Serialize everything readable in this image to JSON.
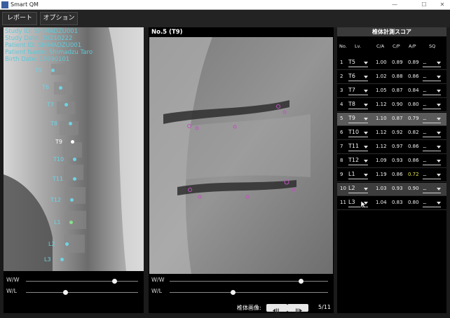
{
  "window": {
    "title": "Smart QM"
  },
  "toolbar": {
    "report_label": "レポート",
    "options_label": "オプション"
  },
  "left_pane": {
    "info": {
      "study_id": "Study ID: SHIMADZU001",
      "study_date": "Study Date: 20210222",
      "patient_id": "Patient ID: SHIMADZU001",
      "patient_name": "Patient Name: Shimadzu Taro",
      "birth_date": "Birth Date: 19990101"
    },
    "vertebrae": [
      "T5",
      "T6",
      "T7",
      "T8",
      "T9",
      "T10",
      "T11",
      "T12",
      "L1",
      "L2",
      "L3"
    ],
    "ww_label": "W/W",
    "wl_label": "W/L",
    "ww_value": 0.79,
    "wl_value": 0.35
  },
  "center_pane": {
    "title": "No.5 (T9)",
    "ww_label": "W/W",
    "wl_label": "W/L",
    "ww_value": 0.83,
    "wl_value": 0.4,
    "nav_label": "椎体画像:",
    "page_counter": "5/11"
  },
  "score_panel": {
    "title": "椎体計測スコア",
    "columns": [
      "No.",
      "Lv.",
      "C/A",
      "C/P",
      "A/P",
      "SQ"
    ],
    "rows": [
      {
        "no": "1",
        "lv": "T5",
        "ca": "1.00",
        "cp": "0.89",
        "ap": "0.89",
        "sq": "..."
      },
      {
        "no": "2",
        "lv": "T6",
        "ca": "1.02",
        "cp": "0.88",
        "ap": "0.86",
        "sq": "..."
      },
      {
        "no": "3",
        "lv": "T7",
        "ca": "1.05",
        "cp": "0.87",
        "ap": "0.84",
        "sq": "..."
      },
      {
        "no": "4",
        "lv": "T8",
        "ca": "1.12",
        "cp": "0.90",
        "ap": "0.80",
        "sq": "..."
      },
      {
        "no": "5",
        "lv": "T9",
        "ca": "1.10",
        "cp": "0.87",
        "ap": "0.79",
        "sq": "..."
      },
      {
        "no": "6",
        "lv": "T10",
        "ca": "1.12",
        "cp": "0.92",
        "ap": "0.82",
        "sq": "..."
      },
      {
        "no": "7",
        "lv": "T11",
        "ca": "1.12",
        "cp": "0.97",
        "ap": "0.86",
        "sq": "..."
      },
      {
        "no": "8",
        "lv": "T12",
        "ca": "1.09",
        "cp": "0.93",
        "ap": "0.86",
        "sq": "..."
      },
      {
        "no": "9",
        "lv": "L1",
        "ca": "1.19",
        "cp": "0.86",
        "ap": "0.72",
        "sq": "..."
      },
      {
        "no": "10",
        "lv": "L2",
        "ca": "1.03",
        "cp": "0.93",
        "ap": "0.90",
        "sq": "..."
      },
      {
        "no": "11",
        "lv": "L3",
        "ca": "1.04",
        "cp": "0.83",
        "ap": "0.80",
        "sq": "..."
      }
    ],
    "selected_row": 4,
    "highlight_row": 9,
    "highlight_ap_row": 8,
    "highlight_color": "#e8e64a"
  },
  "colors": {
    "accent": "#5fc8d8",
    "landmark": "#c050c0"
  }
}
